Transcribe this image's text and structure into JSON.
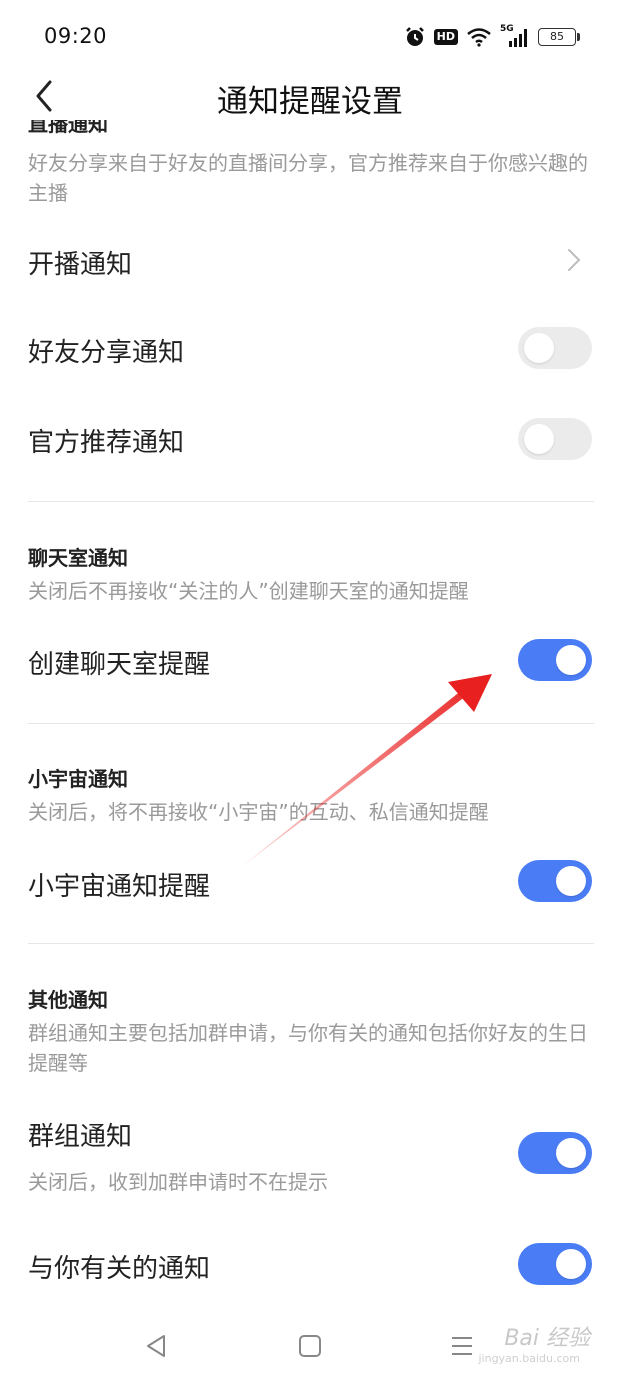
{
  "status_bar": {
    "time": "09:20",
    "hd": "HD",
    "network": "5G",
    "battery": "85"
  },
  "nav": {
    "title": "通知提醒设置"
  },
  "live": {
    "header_cut": "直播通知",
    "description": "好友分享来自于好友的直播间分享，官方推荐来自于你感兴趣的主播",
    "rows": [
      {
        "label": "开播通知"
      },
      {
        "label": "好友分享通知",
        "on": false
      },
      {
        "label": "官方推荐通知",
        "on": false
      }
    ]
  },
  "chatroom": {
    "title": "聊天室通知",
    "description": "关闭后不再接收“关注的人”创建聊天室的通知提醒",
    "rows": [
      {
        "label": "创建聊天室提醒",
        "on": true
      }
    ]
  },
  "universe": {
    "title": "小宇宙通知",
    "description": "关闭后，将不再接收“小宇宙”的互动、私信通知提醒",
    "rows": [
      {
        "label": "小宇宙通知提醒",
        "on": true
      }
    ]
  },
  "other": {
    "title": "其他通知",
    "description": "群组通知主要包括加群申请，与你有关的通知包括你好友的生日提醒等",
    "rows": [
      {
        "label": "群组通知",
        "sub": "关闭后，收到加群申请时不在提示",
        "on": true
      },
      {
        "label": "与你有关的通知",
        "on": true
      }
    ]
  },
  "watermark": {
    "text": "Bai 经验",
    "sub": "jingyan.baidu.com"
  },
  "colors": {
    "accent": "#4a7cf5",
    "toggle_off": "#ebebeb",
    "arrow": "#e8201f"
  },
  "icons": [
    "alarm-icon",
    "wifi-icon",
    "signal-icon",
    "battery-icon",
    "back-icon",
    "chevron-right-icon",
    "nav-back-icon",
    "nav-home-icon",
    "nav-menu-icon"
  ]
}
